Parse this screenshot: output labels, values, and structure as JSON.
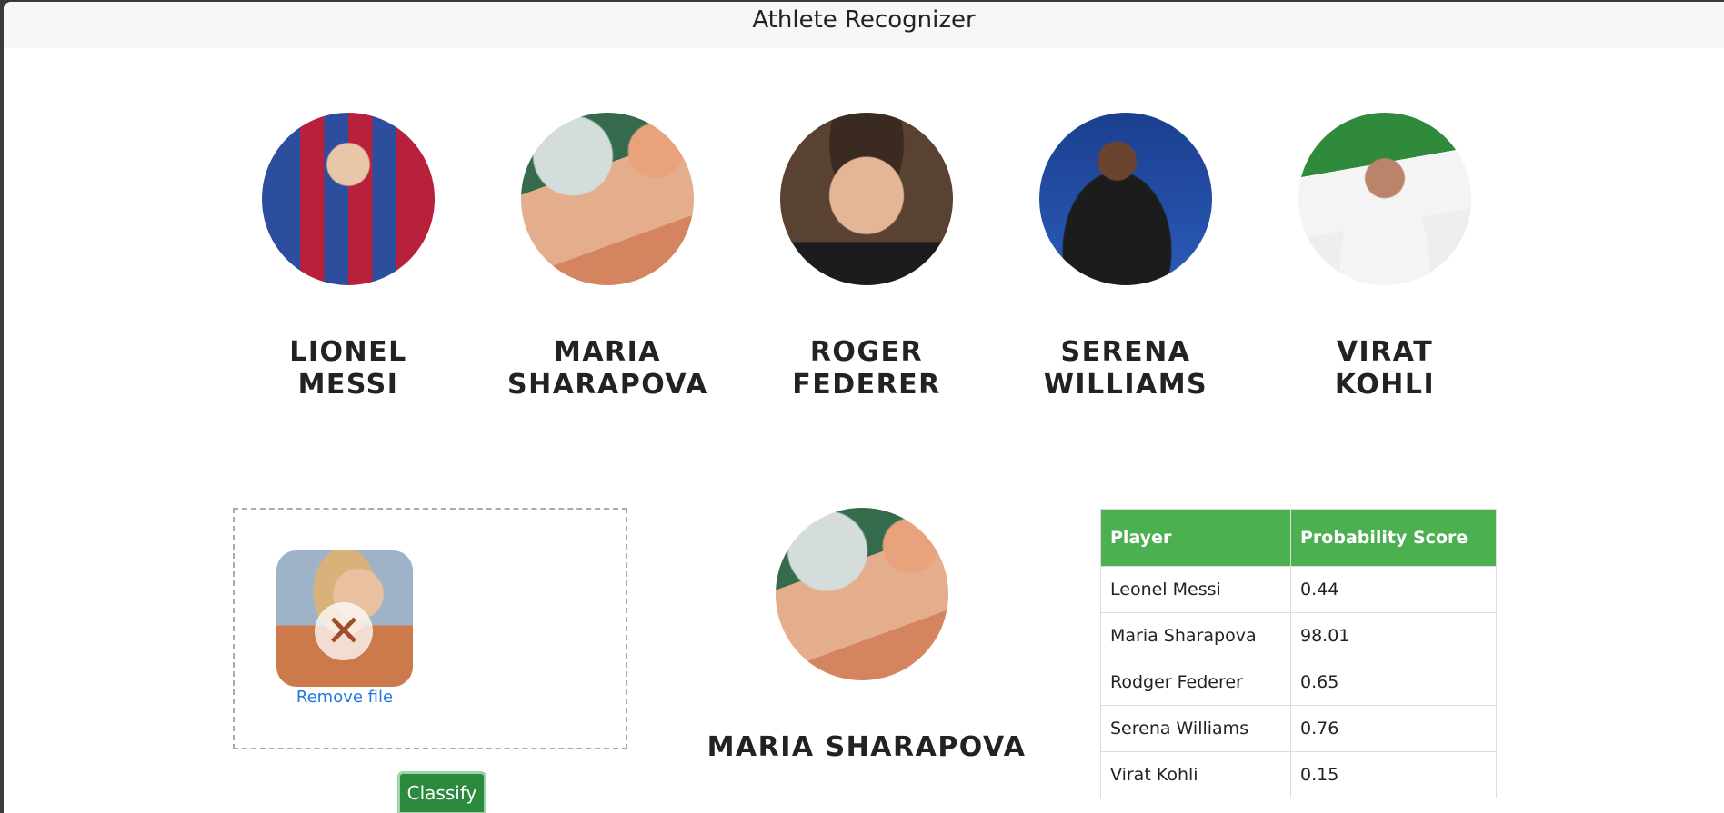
{
  "app": {
    "title": "Athlete Recognizer"
  },
  "athletes": [
    {
      "name_line1": "LIONEL",
      "name_line2": "MESSI"
    },
    {
      "name_line1": "MARIA",
      "name_line2": "SHARAPOVA"
    },
    {
      "name_line1": "ROGER",
      "name_line2": "FEDERER"
    },
    {
      "name_line1": "SERENA",
      "name_line2": "WILLIAMS"
    },
    {
      "name_line1": "VIRAT KOHLI",
      "name_line2": ""
    }
  ],
  "upload": {
    "remove_label": "Remove file",
    "remove_icon": "close-icon"
  },
  "classify_button": "Classify",
  "result": {
    "name": "MARIA SHARAPOVA"
  },
  "table": {
    "headers": [
      "Player",
      "Probability Score"
    ],
    "rows": [
      [
        "Leonel Messi",
        "0.44"
      ],
      [
        "Maria Sharapova",
        "98.01"
      ],
      [
        "Rodger Federer",
        "0.65"
      ],
      [
        "Serena Williams",
        "0.76"
      ],
      [
        "Virat Kohli",
        "0.15"
      ]
    ]
  },
  "colors": {
    "header_green": "#4caf50",
    "button_green": "#2b8a3e",
    "link_blue": "#1e7ad8"
  }
}
